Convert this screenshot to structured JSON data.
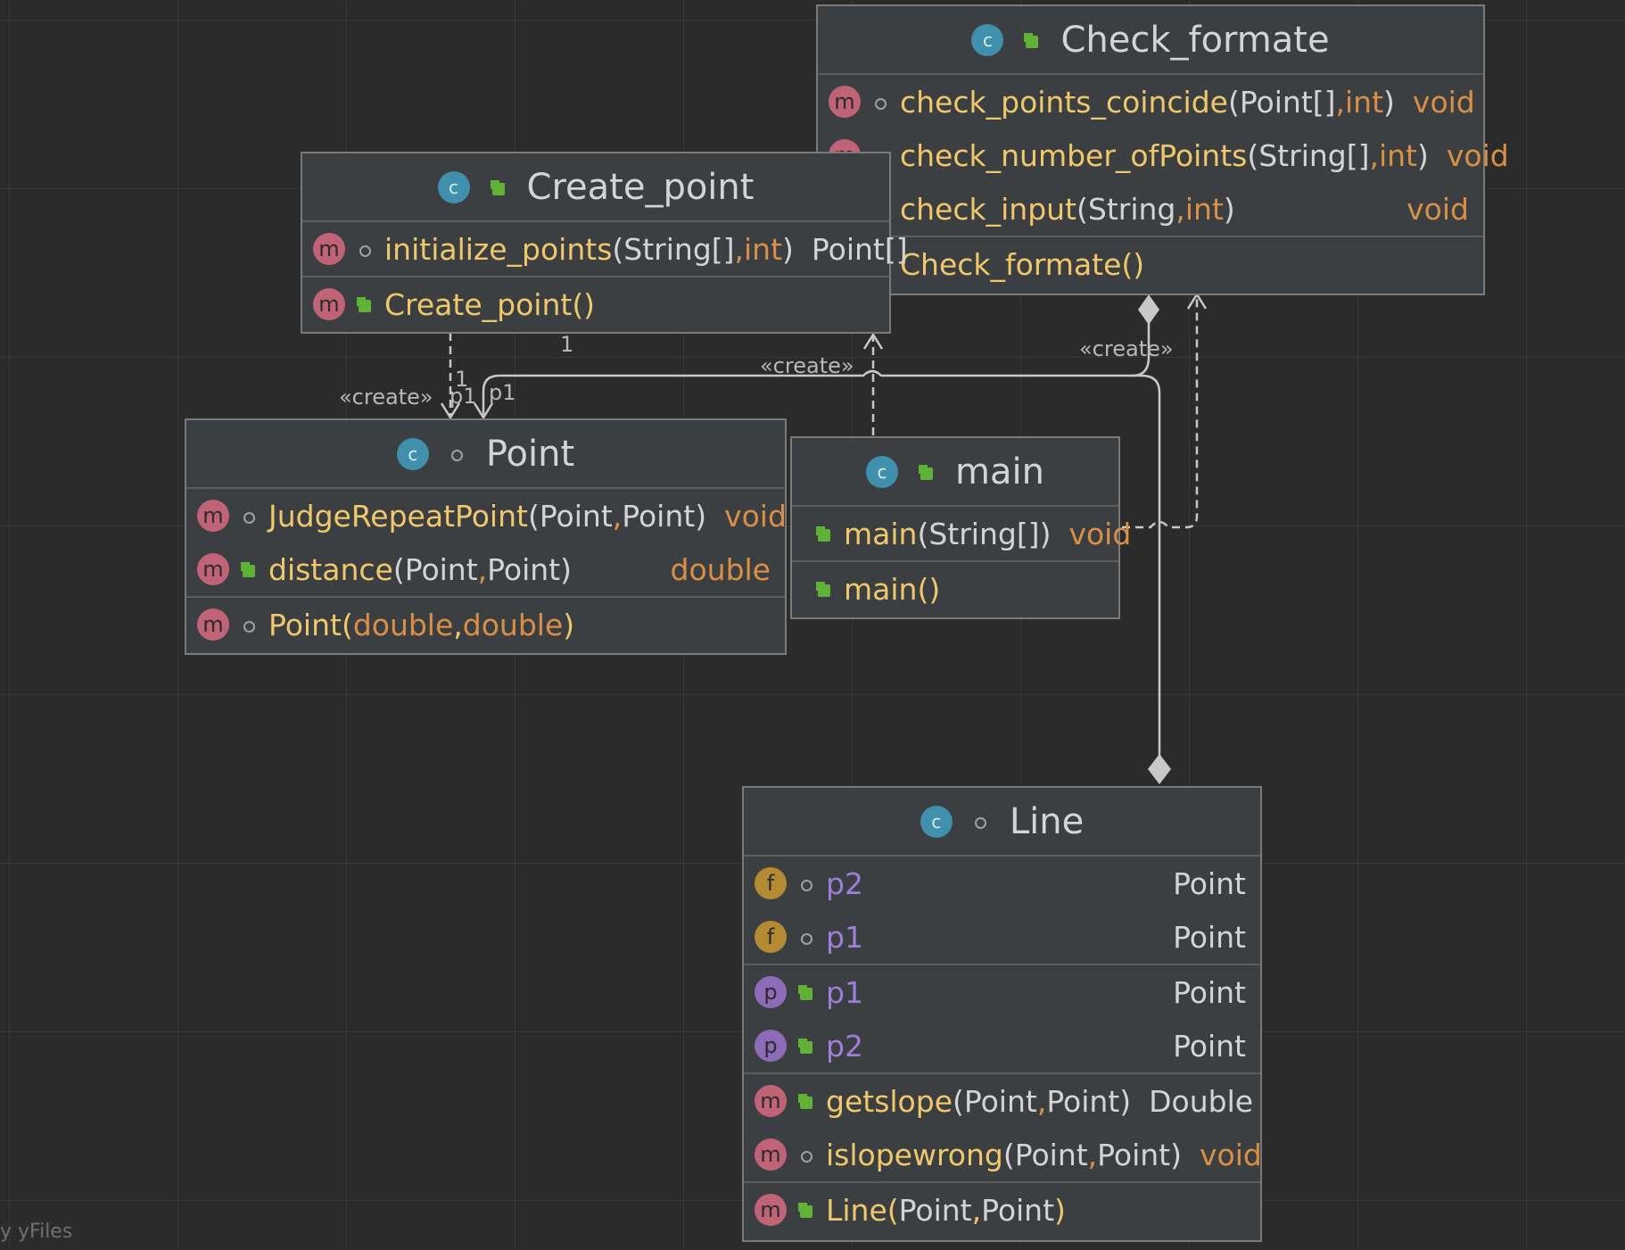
{
  "watermark": "y yFiles",
  "edge_labels": {
    "create_1": "«create»",
    "create_2": "«create»",
    "create_3": "«create»",
    "mult_1": "1",
    "mult_2": "1",
    "role_p1a": "p1",
    "role_p1b": "p1"
  },
  "classes": {
    "check_formate": {
      "name": "Check_formate",
      "methods": [
        {
          "name": "check_points_coincide",
          "params": "Point[], int",
          "p1": "Point[]",
          "p2": "int",
          "ret": "void"
        },
        {
          "name": "check_number_ofPoints",
          "params": "String[], int",
          "p1": "String[]",
          "p2": "int",
          "ret": "void"
        },
        {
          "name": "check_input",
          "params": "String, int",
          "p1": "String",
          "p2": "int",
          "ret": "void"
        }
      ],
      "constructors": [
        {
          "name": "Check_formate",
          "params": "()"
        }
      ]
    },
    "create_point": {
      "name": "Create_point",
      "methods": [
        {
          "name": "initialize_points",
          "p1": "String[]",
          "p2": "int",
          "ret": "Point[]"
        }
      ],
      "constructors": [
        {
          "name": "Create_point",
          "params": "()"
        }
      ]
    },
    "point": {
      "name": "Point",
      "methods": [
        {
          "name": "JudgeRepeatPoint",
          "p1": "Point",
          "p2": "Point",
          "ret": "void"
        },
        {
          "name": "distance",
          "p1": "Point",
          "p2": "Point",
          "ret": "double"
        }
      ],
      "constructors": [
        {
          "name": "Point",
          "p1": "double",
          "p2": "double"
        }
      ]
    },
    "main": {
      "name": "main",
      "methods": [
        {
          "name": "main",
          "p1": "String[]",
          "ret": "void"
        }
      ],
      "constructors": [
        {
          "name": "main",
          "params": "()"
        }
      ]
    },
    "line": {
      "name": "Line",
      "fields": [
        {
          "name": "p2",
          "type": "Point"
        },
        {
          "name": "p1",
          "type": "Point"
        }
      ],
      "properties": [
        {
          "name": "p1",
          "type": "Point"
        },
        {
          "name": "p2",
          "type": "Point"
        }
      ],
      "methods": [
        {
          "name": "getslope",
          "p1": "Point",
          "p2": "Point",
          "ret": "Double"
        },
        {
          "name": "islopewrong",
          "p1": "Point",
          "p2": "Point",
          "ret": "void"
        }
      ],
      "constructors": [
        {
          "name": "Line",
          "p1": "Point",
          "p2": "Point"
        }
      ]
    }
  },
  "badges": {
    "class": "c",
    "method": "m",
    "field": "f",
    "property": "p"
  },
  "icons": {
    "class": "class-icon",
    "method": "method-icon",
    "field": "field-icon",
    "property": "property-icon",
    "public": "public-lock-icon",
    "package": "package-visibility-icon"
  },
  "colors": {
    "background": "#2b2b2b",
    "box": "#3c3f41",
    "method_name": "#f0c86b",
    "field_name": "#9d7ed8",
    "keyword_type": "#d98f45",
    "edge": "#c8c8c8"
  }
}
